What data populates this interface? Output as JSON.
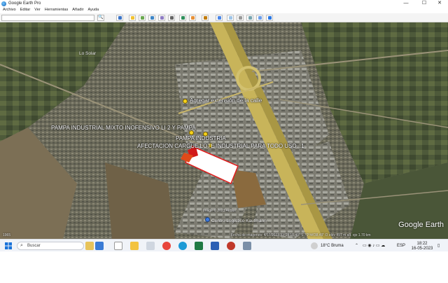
{
  "window": {
    "title": "Google Earth Pro",
    "minimize": "—",
    "maximize": "☐",
    "close": "✕"
  },
  "menu": {
    "items": [
      "Archivo",
      "Editar",
      "Ver",
      "Herramientas",
      "Añadir",
      "Ayuda"
    ]
  },
  "toolbar": {
    "search_placeholder": "",
    "search_button": "🔍"
  },
  "map": {
    "place_lo_solar": "Lo Solar",
    "label_agregar": "Agregar extensión de la calle",
    "label_pampa_mixto": "PAMPA INDUSTRIAL MIXTO INOFENSIVO LI 2 Y PAMPA",
    "label_pampa_industria": "PAMPA INDUSTRIA",
    "label_afectacion": "AFECTACION CARGUE LOTE INDUSTRIAL PARA TODO USO...1",
    "image_credit": "Image © 2023 Airbus",
    "place_centro": "Centro Logístico Kaufmann",
    "status_left": "1965",
    "status_right": "Fecha de imágenes: 4/17/2023    33°28'10.40\" S  70°44'38.49\" O  elev  497 m    alt. ojo  1.70 km",
    "logo": "Google Earth"
  },
  "taskbar": {
    "search_label": "Buscar",
    "weather": "18°C  Bruma",
    "language": "ESP",
    "time": "18:22",
    "date": "16-05-2023"
  }
}
